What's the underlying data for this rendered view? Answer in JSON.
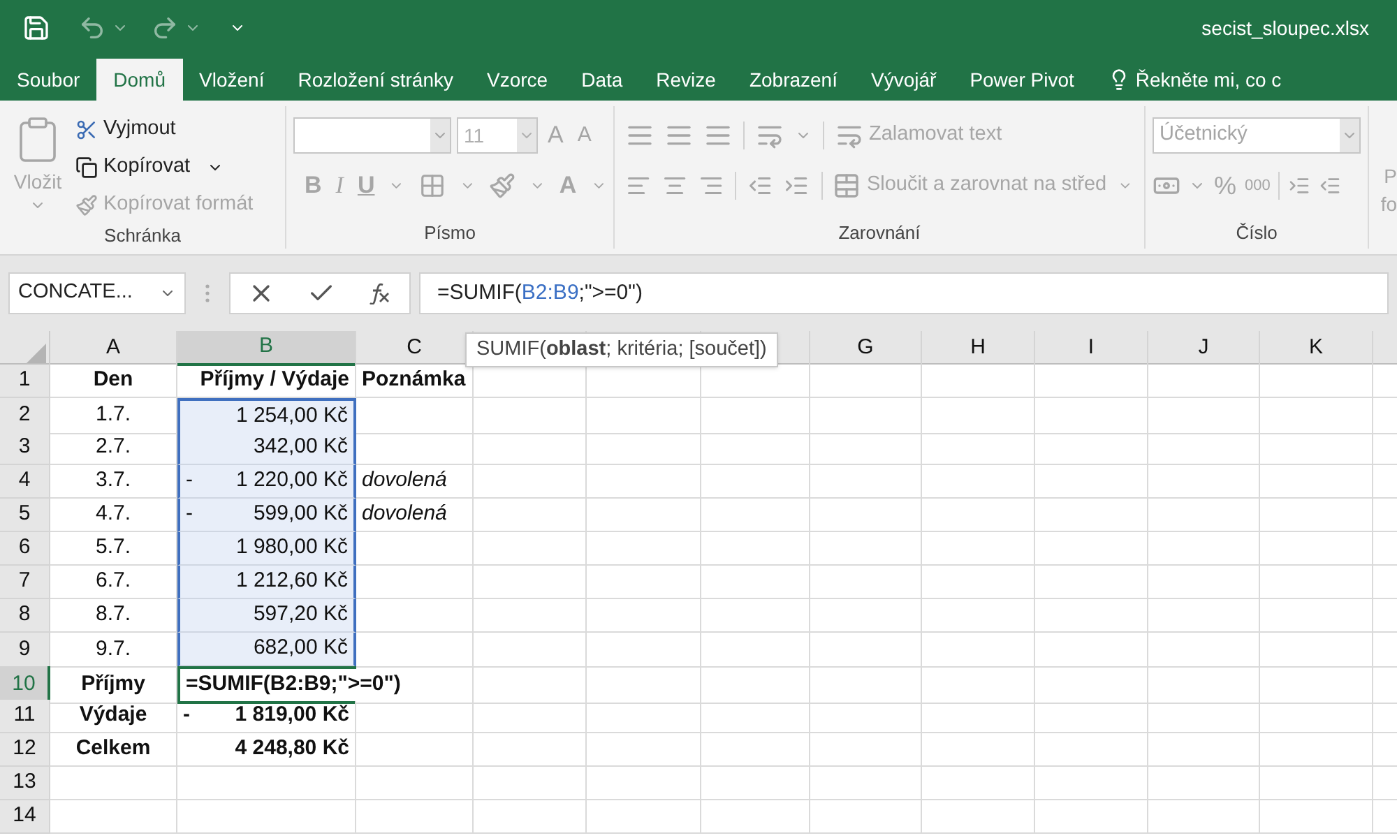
{
  "window": {
    "title": "secist_sloupec.xlsx"
  },
  "ribbon_tabs": [
    {
      "label": "Soubor",
      "selected": false
    },
    {
      "label": "Domů",
      "selected": true
    },
    {
      "label": "Vložení",
      "selected": false
    },
    {
      "label": "Rozložení stránky",
      "selected": false
    },
    {
      "label": "Vzorce",
      "selected": false
    },
    {
      "label": "Data",
      "selected": false
    },
    {
      "label": "Revize",
      "selected": false
    },
    {
      "label": "Zobrazení",
      "selected": false
    },
    {
      "label": "Vývojář",
      "selected": false
    },
    {
      "label": "Power Pivot",
      "selected": false
    }
  ],
  "tell_me": {
    "placeholder": "Řekněte mi, co c"
  },
  "clipboard": {
    "label": "Schránka",
    "paste": {
      "label": "Vložit",
      "disabled": true
    },
    "items": [
      {
        "kind": "cut",
        "label": "Vyjmout",
        "disabled": false
      },
      {
        "kind": "copy",
        "label": "Kopírovat",
        "disabled": false
      },
      {
        "kind": "format",
        "label": "Kopírovat formát",
        "disabled": true
      }
    ]
  },
  "font": {
    "label": "Písmo",
    "size": "11",
    "bold": "B",
    "italic": "I",
    "underline": "U",
    "font_color": "A",
    "grow": "A",
    "shrink": "A"
  },
  "alignment": {
    "label": "Zarovnání",
    "wrap": "Zalamovat text",
    "merge": "Sloučit a zarovnat na střed"
  },
  "number": {
    "label": "Číslo",
    "format": "Účetnický",
    "percent": "%",
    "thousands": "000"
  },
  "cut_group": {
    "line_1": "P",
    "line_2": "fo"
  },
  "name_box": {
    "value": "CONCATE..."
  },
  "formula": [
    {
      "text": "=SUMIF(",
      "kind": "plain"
    },
    {
      "text": "B2:B9",
      "kind": "reference"
    },
    {
      "text": ";\">=0\")",
      "kind": "plain"
    }
  ],
  "tooltip": "SUMIF(**oblast**; kritéria; [součet])",
  "columns": [
    {
      "label": "A",
      "selected": false
    },
    {
      "label": "B",
      "selected": true
    },
    {
      "label": "C",
      "selected": false
    },
    {
      "selected": false
    },
    {
      "selected": false
    },
    {
      "selected": false
    },
    {
      "label": "G",
      "selected": false
    },
    {
      "label": "H",
      "selected": false
    },
    {
      "label": "I",
      "selected": false
    },
    {
      "label": "J",
      "selected": false
    },
    {
      "label": "K",
      "selected": false
    }
  ],
  "rows": [
    {
      "number": "1",
      "selected": false,
      "cells": [
        {
          "text": "Den",
          "kind": "heading"
        },
        {
          "text": "Příjmy / Výdaje",
          "kind": "heading",
          "in_range": false
        },
        {
          "text": "Poznámka",
          "kind": "heading"
        }
      ]
    },
    {
      "number": "2",
      "selected": false,
      "cells": [
        {
          "text": "1.7."
        },
        {
          "text": "1 254,00 Kč",
          "in_range": true
        },
        {}
      ]
    },
    {
      "number": "3",
      "selected": false,
      "cells": [
        {
          "text": "2.7."
        },
        {
          "text": "342,00 Kč",
          "in_range": true
        },
        {}
      ]
    },
    {
      "number": "4",
      "selected": false,
      "cells": [
        {
          "text": "3.7."
        },
        {
          "sign": "-",
          "text": "1 220,00 Kč",
          "in_range": true
        },
        {
          "text": "dovolená",
          "kind": "note"
        }
      ]
    },
    {
      "number": "5",
      "selected": false,
      "cells": [
        {
          "text": "4.7."
        },
        {
          "sign": "-",
          "text": "599,00 Kč",
          "in_range": true
        },
        {
          "text": "dovolená",
          "kind": "note"
        }
      ]
    },
    {
      "number": "6",
      "selected": false,
      "cells": [
        {
          "text": "5.7."
        },
        {
          "text": "1 980,00 Kč",
          "in_range": true
        },
        {}
      ]
    },
    {
      "number": "7",
      "selected": false,
      "cells": [
        {
          "text": "6.7."
        },
        {
          "text": "1 212,60 Kč",
          "in_range": true
        },
        {}
      ]
    },
    {
      "number": "8",
      "selected": false,
      "cells": [
        {
          "text": "8.7."
        },
        {
          "text": "597,20 Kč",
          "in_range": true
        },
        {}
      ]
    },
    {
      "number": "9",
      "selected": false,
      "cells": [
        {
          "text": "9.7."
        },
        {
          "text": "682,00 Kč",
          "in_range": true
        },
        {}
      ]
    },
    {
      "number": "10",
      "selected": true,
      "cells": [
        {
          "text": "Příjmy",
          "kind": "heading"
        },
        {
          "text": "=SUMIF(B2:B9;\">=0\")",
          "kind": "heading",
          "editing": true,
          "in_range": false
        },
        {}
      ]
    },
    {
      "number": "11",
      "selected": false,
      "cells": [
        {
          "text": "Výdaje",
          "kind": "heading"
        },
        {
          "sign": "-",
          "text": "1 819,00 Kč",
          "kind": "heading",
          "in_range": false
        },
        {}
      ]
    },
    {
      "number": "12",
      "selected": false,
      "cells": [
        {
          "text": "Celkem",
          "kind": "heading"
        },
        {
          "text": "4 248,80 Kč",
          "kind": "heading",
          "in_range": false
        },
        {}
      ]
    },
    {
      "number": "13",
      "selected": false,
      "cells": [
        {},
        {
          "in_range": false
        },
        {}
      ]
    },
    {
      "number": "14",
      "selected": false,
      "cells": [
        {},
        {
          "in_range": false
        },
        {}
      ]
    }
  ]
}
